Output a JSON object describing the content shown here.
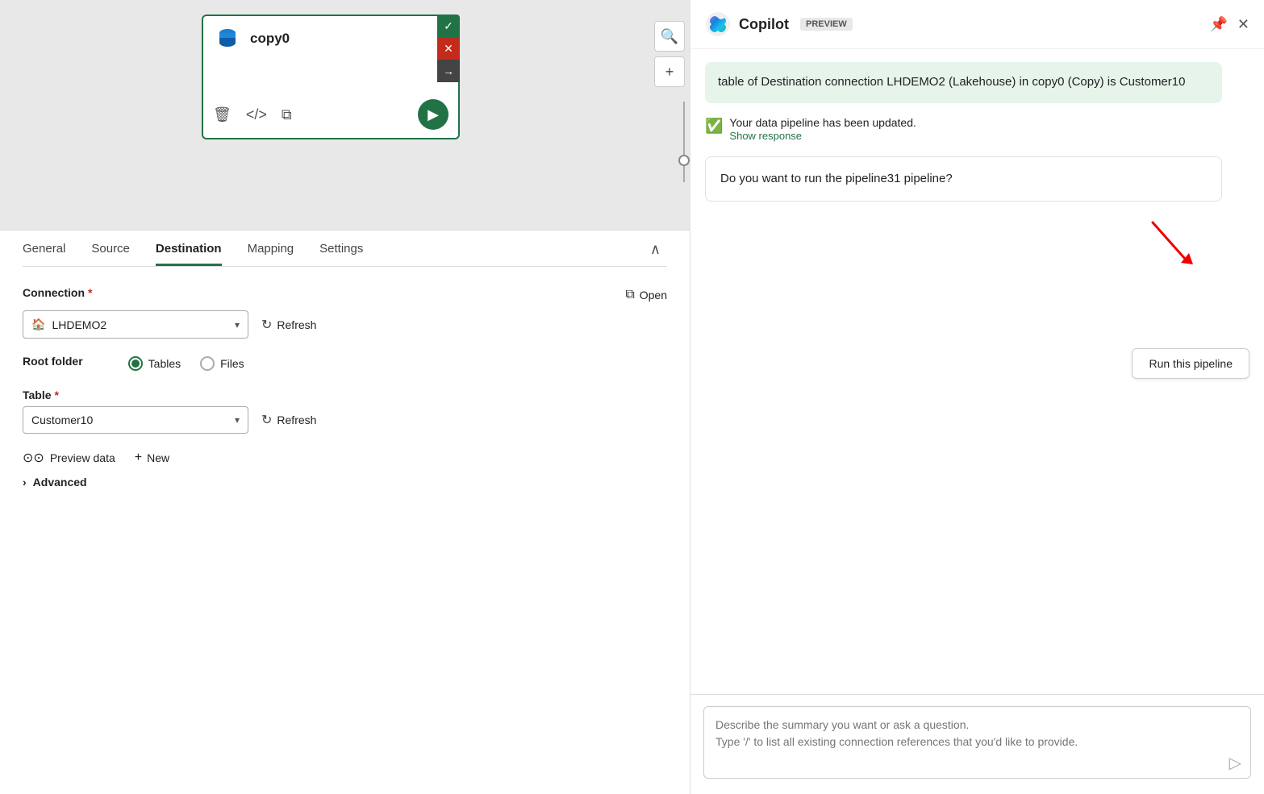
{
  "canvas": {
    "node": {
      "title": "copy0",
      "icon_alt": "database"
    },
    "tools": {
      "search": "🔍",
      "plus": "+",
      "zoom": "zoom"
    }
  },
  "config_panel": {
    "tabs": [
      {
        "id": "general",
        "label": "General",
        "active": false
      },
      {
        "id": "source",
        "label": "Source",
        "active": false
      },
      {
        "id": "destination",
        "label": "Destination",
        "active": true
      },
      {
        "id": "mapping",
        "label": "Mapping",
        "active": false
      },
      {
        "id": "settings",
        "label": "Settings",
        "active": false
      }
    ],
    "connection": {
      "label": "Connection",
      "value": "LHDEMO2",
      "required": true,
      "open_label": "Open",
      "refresh_label": "Refresh"
    },
    "root_folder": {
      "label": "Root folder",
      "options": [
        {
          "id": "tables",
          "label": "Tables",
          "selected": true
        },
        {
          "id": "files",
          "label": "Files",
          "selected": false
        }
      ]
    },
    "table": {
      "label": "Table",
      "value": "Customer10",
      "required": true,
      "refresh_label": "Refresh"
    },
    "preview_data_label": "Preview data",
    "new_label": "New",
    "advanced_label": "Advanced"
  },
  "copilot": {
    "title": "Copilot",
    "preview_badge": "PREVIEW",
    "messages": [
      {
        "type": "bubble",
        "text": "table of Destination connection LHDEMO2 (Lakehouse) in copy0 (Copy) is Customer10"
      },
      {
        "type": "system",
        "check": "✅",
        "text": "Your data pipeline has been updated.",
        "link": "Show response"
      },
      {
        "type": "question",
        "text": "Do you want to run the pipeline31 pipeline?"
      }
    ],
    "run_pipeline_label": "Run this pipeline",
    "input_placeholder": "Describe the summary you want or ask a question.\nType '/' to list all existing connection references that you'd like to provide."
  }
}
